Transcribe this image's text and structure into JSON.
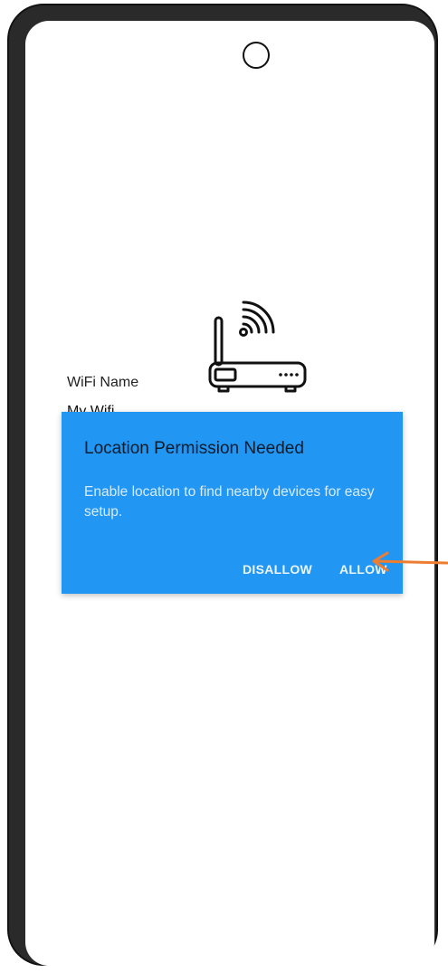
{
  "wifi": {
    "name_label": "WiFi Name",
    "name_value": "My Wifi"
  },
  "dialog": {
    "title": "Location Permission Needed",
    "message": "Enable location to find nearby devices for easy setup.",
    "disallow_label": "DISALLOW",
    "allow_label": "ALLOW"
  },
  "icons": {
    "router": "router-wifi-icon",
    "camera": "front-camera",
    "annotation": "arrow-pointer-icon"
  },
  "colors": {
    "dialog_bg": "#2196f3",
    "arrow": "#ed7d31",
    "frame": "#2a2a2a"
  }
}
